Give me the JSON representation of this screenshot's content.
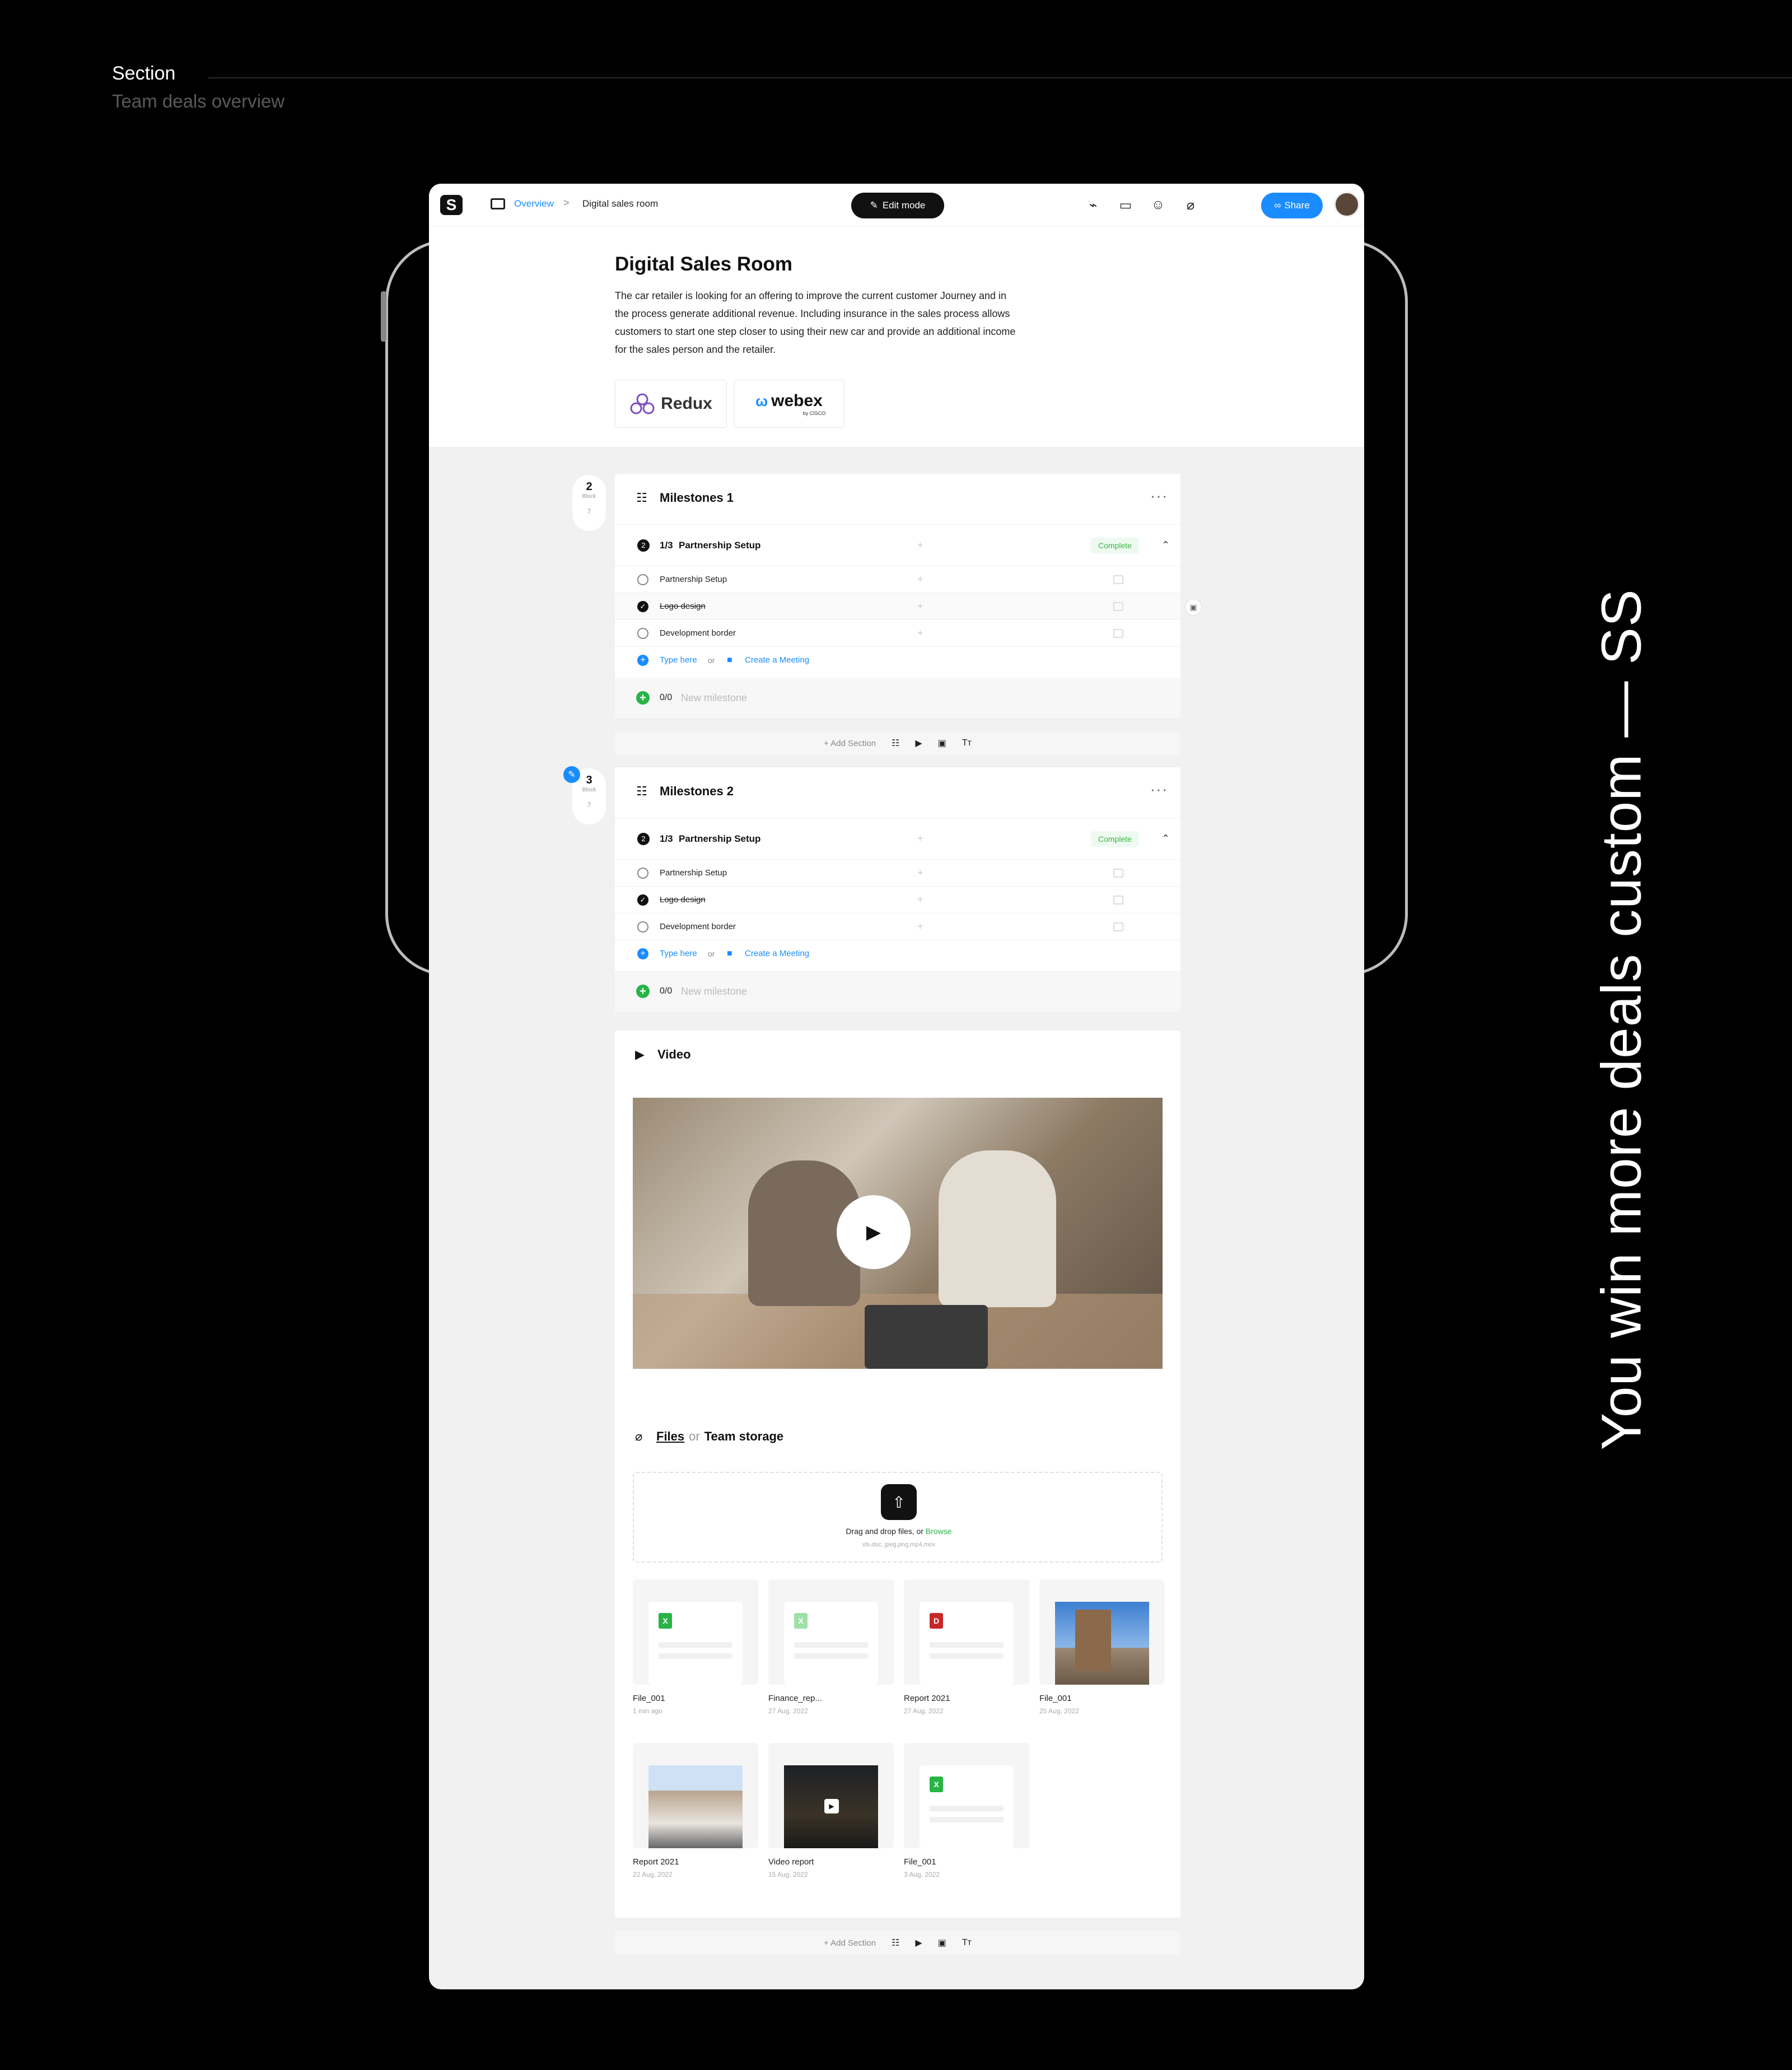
{
  "section": {
    "title": "Section",
    "subtitle": "Team deals overview"
  },
  "tagline": "You win more deals custom — SS",
  "topbar": {
    "logo": "S",
    "breadcrumb_1": "Overview",
    "breadcrumb_sep": ">",
    "breadcrumb_2": "Digital sales room",
    "edit_mode": "Edit mode",
    "share": "Share"
  },
  "hero": {
    "title": "Digital Sales Room",
    "description": "The car retailer is looking for an offering to improve the current customer Journey and in the process generate additional revenue. Including insurance in the sales process allows customers to start one step closer to using their new car and provide an additional income for the sales person and the retailer.",
    "partners": [
      "Redux",
      "webex"
    ],
    "webex_sub": "by CISCO"
  },
  "milestones": [
    {
      "block_number": "2",
      "block_label": "Block",
      "block_count": "7",
      "title": "Milestones 1",
      "phase_count": "1/3",
      "phase_title": "Partnership Setup",
      "phase_status": "Complete",
      "tasks": [
        {
          "label": "Partnership Setup",
          "done": false
        },
        {
          "label": "Logo design",
          "done": true
        },
        {
          "label": "Development border",
          "done": false
        }
      ],
      "type_here": "Type here",
      "or": "or",
      "create_meeting": "Create a Meeting",
      "new_count": "0/0",
      "new_placeholder": "New milestone"
    },
    {
      "block_number": "3",
      "block_label": "Block",
      "block_count": "7",
      "title": "Milestones 2",
      "phase_count": "1/3",
      "phase_title": "Partnership Setup",
      "phase_status": "Complete",
      "tasks": [
        {
          "label": "Partnership Setup",
          "done": false
        },
        {
          "label": "Logo design",
          "done": true
        },
        {
          "label": "Development border",
          "done": false
        }
      ],
      "type_here": "Type here",
      "or": "or",
      "create_meeting": "Create a Meeting",
      "new_count": "0/0",
      "new_placeholder": "New milestone"
    }
  ],
  "add_section": "Add Section",
  "video": {
    "title": "Video"
  },
  "files": {
    "title_files": "Files",
    "title_or": "or",
    "title_storage": "Team storage",
    "drop_text": "Drag and drop files, or",
    "browse": "Browse",
    "formats": "xls,doc, jpeg,png,mp4,mov",
    "items": [
      {
        "name": "File_001",
        "date": "1 min ago",
        "kind": "xls"
      },
      {
        "name": "Finance_rep...",
        "date": "27 Aug, 2022",
        "kind": "xls-light"
      },
      {
        "name": "Report 2021",
        "date": "27 Aug, 2022",
        "kind": "pdf"
      },
      {
        "name": "File_001",
        "date": "25 Aug, 2022",
        "kind": "image"
      },
      {
        "name": "Report 2021",
        "date": "22 Aug, 2022",
        "kind": "image"
      },
      {
        "name": "Video report",
        "date": "15 Aug, 2022",
        "kind": "video"
      },
      {
        "name": "File_001",
        "date": "3 Aug, 2022",
        "kind": "xls"
      }
    ]
  },
  "colors": {
    "accent": "#1a8cff",
    "success": "#28b446",
    "dark": "#111111",
    "page_bg": "#000000",
    "canvas_bg": "#f1f1f1"
  }
}
